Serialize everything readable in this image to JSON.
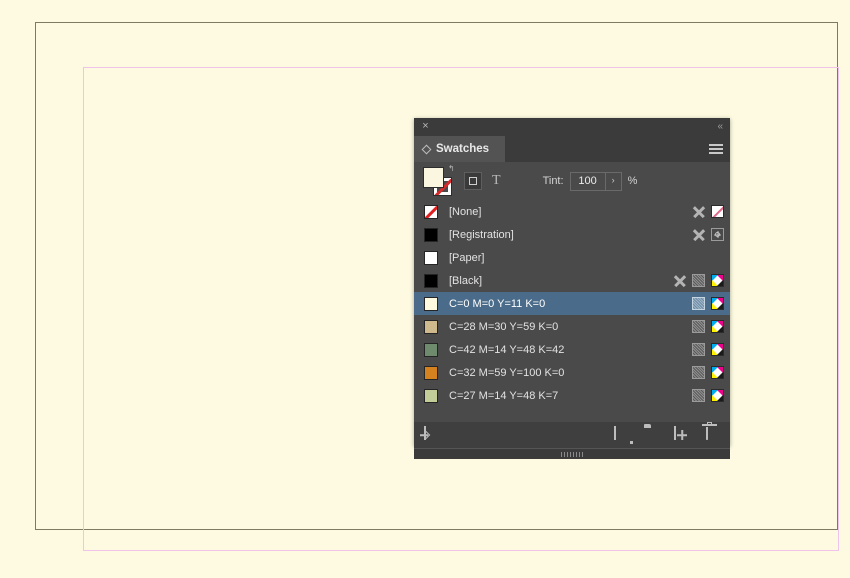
{
  "document": {
    "background_color": "#fdfae1",
    "page_border_color": "#7d7a63",
    "margin_guide_color": "#f0c4ea"
  },
  "panel": {
    "title": "Swatches",
    "close_icon": "×",
    "collapse_icon": "«",
    "menu_icon": "hamburger-menu-icon",
    "selection_color": "#4a6c8a",
    "background_color": "#4a4a4a"
  },
  "options": {
    "fill_color": "#faf6e0",
    "stroke_value": "None",
    "swap_icon": "↰",
    "container_button_label": "formatting-affects-container",
    "text_button_label": "T",
    "tint_label": "Tint:",
    "tint_value": "100",
    "tint_placeholder": "100",
    "tint_arrow_icon": "›",
    "tint_unit": "%"
  },
  "swatches": [
    {
      "name": "[None]",
      "chip_type": "none",
      "chip_color": "#ffffff",
      "selected": false,
      "icons": [
        "pen-icon",
        "none-swatch-icon"
      ]
    },
    {
      "name": "[Registration]",
      "chip_type": "solid",
      "chip_color": "#000000",
      "selected": false,
      "icons": [
        "pen-icon",
        "registration-target-icon"
      ]
    },
    {
      "name": "[Paper]",
      "chip_type": "solid",
      "chip_color": "#ffffff",
      "selected": false,
      "icons": []
    },
    {
      "name": "[Black]",
      "chip_type": "solid",
      "chip_color": "#000000",
      "selected": false,
      "icons": [
        "pen-icon",
        "tint-ramp-icon",
        "cmyk-icon"
      ]
    },
    {
      "name": "C=0 M=0 Y=11 K=0",
      "chip_type": "solid",
      "chip_color": "#fdfae0",
      "selected": true,
      "icons": [
        "tint-ramp-icon",
        "cmyk-icon"
      ]
    },
    {
      "name": "C=28 M=30 Y=59 K=0",
      "chip_type": "solid",
      "chip_color": "#cfba8d",
      "selected": false,
      "icons": [
        "tint-ramp-icon",
        "cmyk-icon"
      ]
    },
    {
      "name": "C=42 M=14 Y=48 K=42",
      "chip_type": "solid",
      "chip_color": "#6f8b6d",
      "selected": false,
      "icons": [
        "tint-ramp-icon",
        "cmyk-icon"
      ]
    },
    {
      "name": "C=32 M=59 Y=100 K=0",
      "chip_type": "solid",
      "chip_color": "#d4821f",
      "selected": false,
      "icons": [
        "tint-ramp-icon",
        "cmyk-icon"
      ]
    },
    {
      "name": "C=27 M=14 Y=48 K=7",
      "chip_type": "solid",
      "chip_color": "#c3cd97",
      "selected": false,
      "icons": [
        "tint-ramp-icon",
        "cmyk-icon"
      ]
    }
  ],
  "footer": {
    "cc_library_label": "Add selected swatch to CC library",
    "color_group_label": "New color group",
    "folder_label": "New color group folder",
    "new_swatch_label": "New swatch",
    "delete_label": "Delete swatch"
  }
}
